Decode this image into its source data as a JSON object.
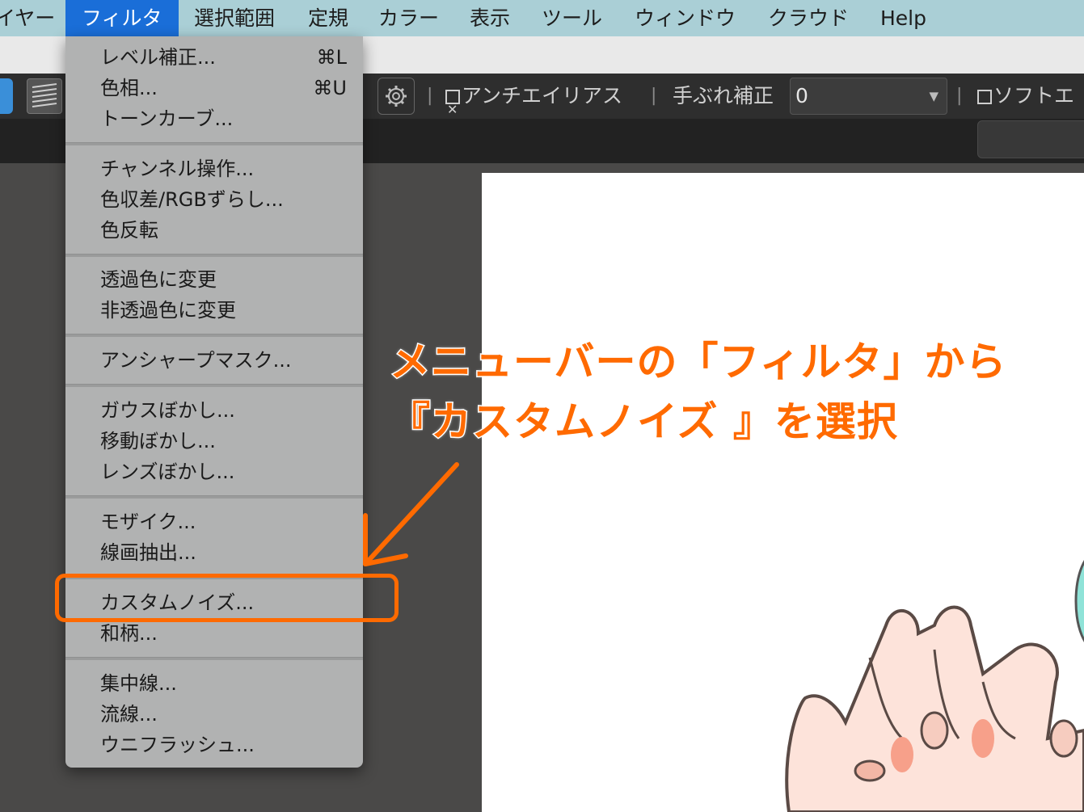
{
  "menubar": {
    "items": [
      {
        "label": "イヤー"
      },
      {
        "label": "フィルタ"
      },
      {
        "label": "選択範囲"
      },
      {
        "label": "定規"
      },
      {
        "label": "カラー"
      },
      {
        "label": "表示"
      },
      {
        "label": "ツール"
      },
      {
        "label": "ウィンドウ"
      },
      {
        "label": "クラウド"
      },
      {
        "label": "Help"
      }
    ]
  },
  "options": {
    "antialias_label": "アンチエイリアス",
    "stabilizer_label": "手ぶれ補正",
    "stabilizer_value": "0",
    "soft_edge_label": "ソフトエ"
  },
  "filter_menu": {
    "groups": [
      [
        {
          "label": "レベル補正...",
          "shortcut": "⌘L"
        },
        {
          "label": "色相...",
          "shortcut": "⌘U"
        },
        {
          "label": "トーンカーブ...",
          "shortcut": ""
        }
      ],
      [
        {
          "label": "チャンネル操作..."
        },
        {
          "label": "色収差/RGBずらし..."
        },
        {
          "label": "色反転"
        }
      ],
      [
        {
          "label": "透過色に変更"
        },
        {
          "label": "非透過色に変更"
        }
      ],
      [
        {
          "label": "アンシャープマスク..."
        }
      ],
      [
        {
          "label": "ガウスぼかし..."
        },
        {
          "label": "移動ぼかし..."
        },
        {
          "label": "レンズぼかし..."
        }
      ],
      [
        {
          "label": "モザイク..."
        },
        {
          "label": "線画抽出..."
        }
      ],
      [
        {
          "label": "カスタムノイズ..."
        },
        {
          "label": "和柄..."
        }
      ],
      [
        {
          "label": "集中線..."
        },
        {
          "label": "流線..."
        },
        {
          "label": "ウニフラッシュ..."
        }
      ]
    ]
  },
  "annotation": {
    "line1": "メニューバーの「フィルタ」から",
    "line2": "『カスタムノイズ 』を選択",
    "color": "#ff6a00"
  }
}
